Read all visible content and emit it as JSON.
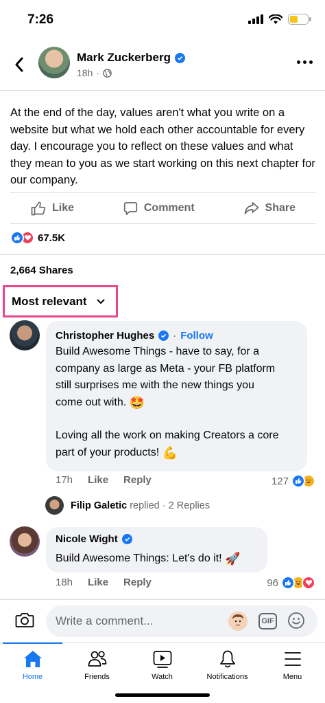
{
  "status_bar": {
    "time": "7:26"
  },
  "post": {
    "author": "Mark Zuckerberg",
    "time": "18h",
    "text": "At the end of the day, values aren't what you write on a website but what we hold each other accountable for every day. I encourage you to reflect on these values and what they mean to you as we start working on this next chapter for our company.",
    "actions": {
      "like": "Like",
      "comment": "Comment",
      "share": "Share"
    },
    "reaction_count": "67.5K",
    "shares": "2,664 Shares"
  },
  "sort": {
    "label": "Most relevant"
  },
  "comments": [
    {
      "author": "Christopher Hughes",
      "follow": "Follow",
      "separator": "·",
      "lines": [
        "Build Awesome Things - have to say, for a",
        "company as large as Meta - your FB platform",
        "still surprises me with the new things you",
        "come out with."
      ],
      "emoji1": "🤩",
      "lines2": [
        "Loving all the work on making Creators a core",
        "part of your products!"
      ],
      "emoji2": "💪",
      "time": "17h",
      "like": "Like",
      "reply": "Reply",
      "count": "127",
      "reply_preview": {
        "name": "Filip Galetic",
        "action": "replied",
        "count": "· 2 Replies"
      }
    },
    {
      "author": "Nicole Wight",
      "text": "Build Awesome Things: Let's do it!",
      "emoji": "🚀",
      "time": "18h",
      "like": "Like",
      "reply": "Reply",
      "count": "96"
    }
  ],
  "composer": {
    "placeholder": "Write a comment...",
    "gif": "GIF"
  },
  "tabs": [
    {
      "label": "Home",
      "icon": "home-icon",
      "active": true
    },
    {
      "label": "Friends",
      "icon": "friends-icon"
    },
    {
      "label": "Watch",
      "icon": "watch-icon"
    },
    {
      "label": "Notifications",
      "icon": "bell-icon"
    },
    {
      "label": "Menu",
      "icon": "menu-icon"
    }
  ],
  "colors": {
    "accent": "#1877f2",
    "highlight": "#e8478b",
    "love": "#f33e58",
    "haha": "#f7b125"
  }
}
